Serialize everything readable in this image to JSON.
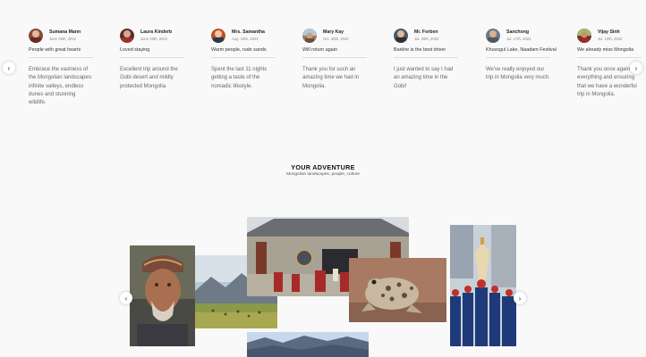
{
  "reviews": [
    {
      "name": "Sumana Mann",
      "date": "June 26th, 2022",
      "title": "People with great hearts",
      "body": "Embrace the vastness of the Mongolian landscapes: infinite valleys, endless dunes and stunning wildlife.",
      "avatar_color": "#8a4a3a"
    },
    {
      "name": "Laura Kinderb",
      "date": "June 29th, 2022",
      "title": "Loved staying",
      "body": "Excellent trip around the Gobi desert and mildly protected Mongolia.",
      "avatar_color": "#5a3028"
    },
    {
      "name": "Mrs. Samantha",
      "date": "Aug. 15th, 2022",
      "title": "Warm people, rude sands",
      "body": "Spent the last 11 nights getting a taste of the nomadic lifestyle.",
      "avatar_color": "#c0502a"
    },
    {
      "name": "Mary Kay",
      "date": "Oct. 30th, 2022",
      "title": "Will return again",
      "body": "Thank you for such an amazing time we had in Mongolia.",
      "avatar_color": "#9a7a5a"
    },
    {
      "name": "Mr. Forben",
      "date": "Jul. 28th, 2022",
      "title": "Barkhe is the best driver",
      "body": "I just wanted to say I had an amazing time in the Gobi!",
      "avatar_color": "#4a5a6a"
    },
    {
      "name": "Sanchong",
      "date": "Jul. 17th, 2022",
      "title": "Khuvsgul Lake, Naadam Festival",
      "body": "We've really enjoyed our trip in Mongolia very much.",
      "avatar_color": "#6a7a8a"
    },
    {
      "name": "Vijay Sinh",
      "date": "Jul. 10th, 2022",
      "title": "We already miss Mongolia",
      "body": "Thank you once again for everything and ensuring that we have a wonderful trip in Mongolia.",
      "avatar_color": "#7a3030"
    }
  ],
  "nav": {
    "prev": "‹",
    "next": "›"
  },
  "adventure": {
    "title": "YOUR ADVENTURE",
    "subtitle": "Mongolian landscapes, people, culture",
    "prev": "‹",
    "next": "›"
  },
  "photos": [
    {
      "name": "photo-elder-man",
      "subject": "elderly man in embroidered cap"
    },
    {
      "name": "photo-steppe-herd",
      "subject": "herd on steppe with mountains"
    },
    {
      "name": "photo-monastery",
      "subject": "monastery gate with monks"
    },
    {
      "name": "photo-toad",
      "subject": "spotted toad"
    },
    {
      "name": "photo-naadam-guards",
      "subject": "ceremonial guards in blue uniforms"
    },
    {
      "name": "photo-mountain-lake",
      "subject": "mountains under blue sky"
    }
  ]
}
